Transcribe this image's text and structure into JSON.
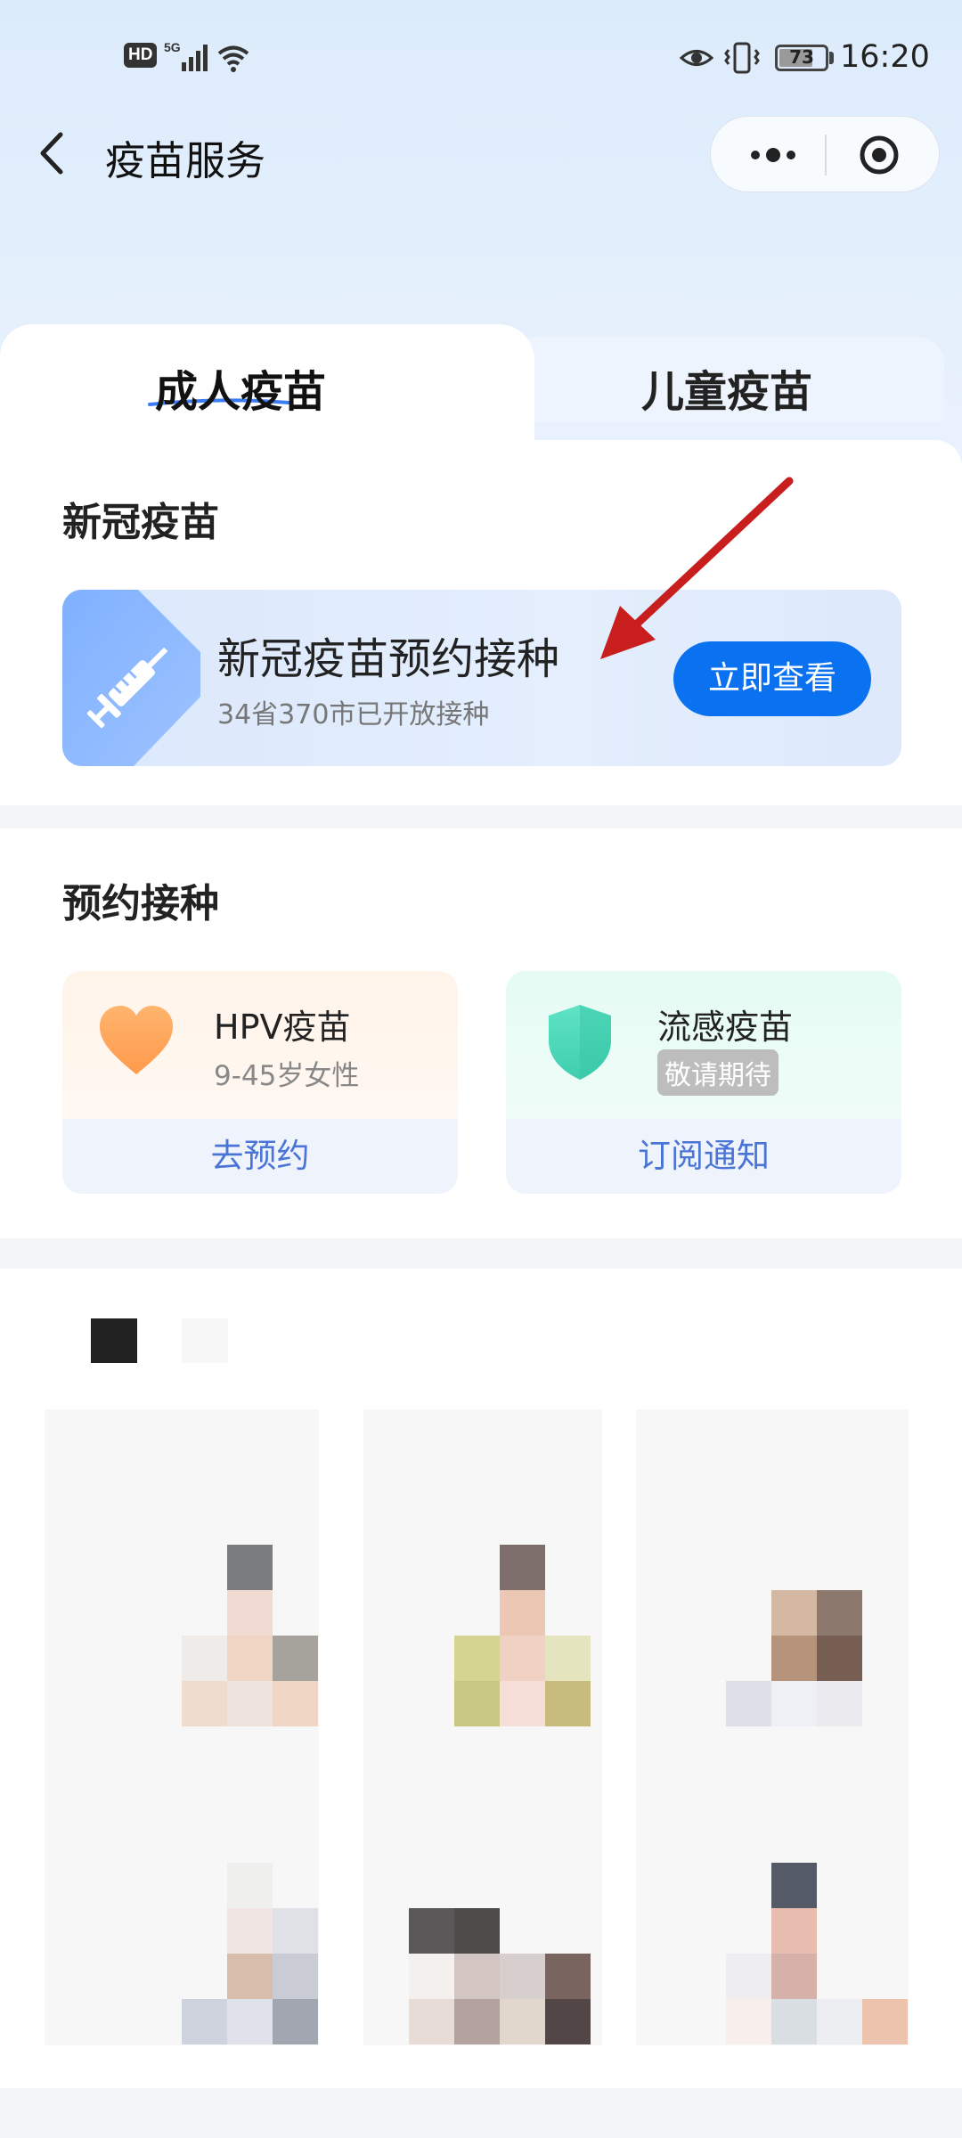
{
  "status_bar": {
    "hd_label": "HD",
    "network_label": "5G",
    "battery": "73",
    "time": "16:20"
  },
  "nav": {
    "title": "疫苗服务"
  },
  "tabs": {
    "adult": "成人疫苗",
    "child": "儿童疫苗"
  },
  "covid_section": {
    "title": "新冠疫苗",
    "banner_title": "新冠疫苗预约接种",
    "banner_subtitle": "34省370市已开放接种",
    "banner_button": "立即查看"
  },
  "booking_section": {
    "title": "预约接种",
    "cards": [
      {
        "name": "HPV疫苗",
        "subtitle": "9-45岁女性",
        "action": "去预约",
        "icon": "heart-icon",
        "color": "#ffa35c"
      },
      {
        "name": "流感疫苗",
        "badge": "敬请期待",
        "action": "订阅通知",
        "icon": "shield-icon",
        "color": "#4fd9b8"
      }
    ]
  },
  "colors": {
    "accent": "#0a72f0",
    "link": "#4a74d6",
    "arrow": "#c81e1e"
  }
}
